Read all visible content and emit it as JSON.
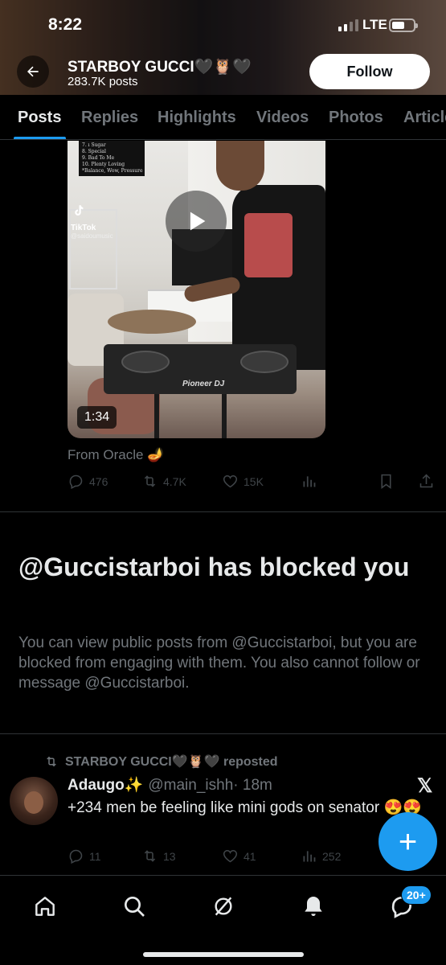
{
  "status_bar": {
    "time": "8:22",
    "network": "LTE"
  },
  "profile": {
    "name": "STARBOY GUCCI🖤🦉🖤",
    "posts_count": "283.7K posts",
    "follow_label": "Follow"
  },
  "tabs": [
    "Posts",
    "Replies",
    "Highlights",
    "Videos",
    "Photos",
    "Articles"
  ],
  "video_post": {
    "tracklist": [
      "7. ı Sugar",
      "8. Special",
      "9. Bad To Me",
      "10. Plenty Loving",
      "*Balance, Wow, Pressure"
    ],
    "tiktok_label": "TikTok",
    "tiktok_user": "@saidoumusic",
    "mixer_brand": "Pioneer DJ",
    "duration": "1:34",
    "from_text": "From Oracle 🪔",
    "replies": "476",
    "reposts": "4.7K",
    "likes": "15K"
  },
  "blocked": {
    "title": "@Guccistarboi has blocked you",
    "description": "You can view public posts from @Guccistarboi, but you are blocked from engaging with them. You also cannot follow or message @Guccistarboi."
  },
  "repost": {
    "reposter": "STARBOY GUCCI🖤🦉🖤 reposted",
    "author_name": "Adaugo✨",
    "handle": "@main_ishh",
    "time": "· 18m",
    "text": "+234 men be feeling like mini gods on senator 😍😍",
    "replies": "11",
    "reposts": "13",
    "likes": "41",
    "views": "252"
  },
  "x_logo": "𝕏",
  "fab_label": "+",
  "nav": {
    "badge": "20+"
  },
  "colors": {
    "accent": "#1d9bf0",
    "background": "#000000",
    "muted": "#71767b"
  }
}
